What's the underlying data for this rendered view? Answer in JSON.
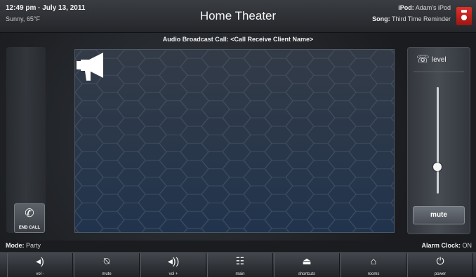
{
  "topbar": {
    "time": "12:49 pm · July 13, 2011",
    "weather": "Sunny, 65°F",
    "title": "Home Theater",
    "source_label": "iPod:",
    "source_value": "Adam's iPod",
    "song_label": "Song:",
    "song_value": "Third Time Reminder",
    "ipod_icon": "ipod-icon"
  },
  "call": {
    "caption": "Audio Broadcast Call: <Call Receive Client Name>",
    "stage_icon": "megaphone-icon",
    "end_call_label": "END CALL",
    "end_call_icon": "phone-muted-icon"
  },
  "volume": {
    "label": "level",
    "icon": "speaker-phone-icon",
    "level": 0.25,
    "mute_label": "mute"
  },
  "status": {
    "mode_label": "Mode:",
    "mode_value": "Party",
    "alarm_label": "Alarm Clock:",
    "alarm_value": "ON"
  },
  "nav": [
    {
      "label": "vol -",
      "icon": "volume-down-icon",
      "glyph": "◂)"
    },
    {
      "label": "mute",
      "icon": "mute-icon",
      "glyph": "⍉"
    },
    {
      "label": "vol +",
      "icon": "volume-up-icon",
      "glyph": "◂))"
    },
    {
      "label": "main",
      "icon": "main-menu-icon",
      "glyph": "☷"
    },
    {
      "label": "shortcuts",
      "icon": "shortcuts-icon",
      "glyph": "⏏"
    },
    {
      "label": "rooms",
      "icon": "home-icon",
      "glyph": "⌂"
    },
    {
      "label": "power",
      "icon": "power-icon",
      "glyph": "⏻"
    }
  ]
}
